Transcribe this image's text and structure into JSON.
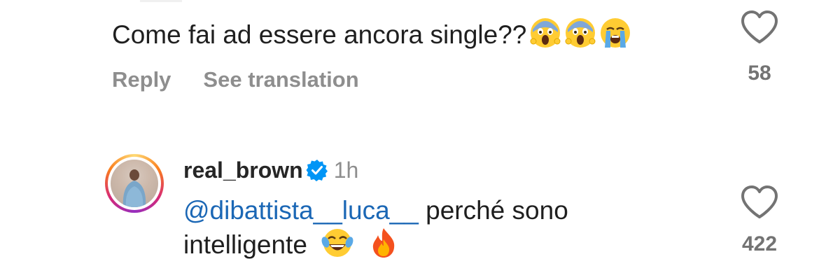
{
  "comment1": {
    "text": "Come fai ad essere ancora single??",
    "emojis": [
      "face-screaming-in-fear",
      "face-screaming-in-fear",
      "loudly-crying-face"
    ],
    "reply_label": "Reply",
    "translate_label": "See translation",
    "like_count": "58"
  },
  "comment2": {
    "username": "real_brown",
    "time": "1h",
    "mention": "@dibattista__luca__",
    "text_after_mention": "perché sono",
    "text_line2": "intelligente",
    "emojis": [
      "face-with-tears-of-joy",
      "fire"
    ],
    "like_count": "422"
  },
  "colors": {
    "mention": "#1b67b5",
    "verified": "#0095f6",
    "secondary_text": "#8e8e8e"
  }
}
